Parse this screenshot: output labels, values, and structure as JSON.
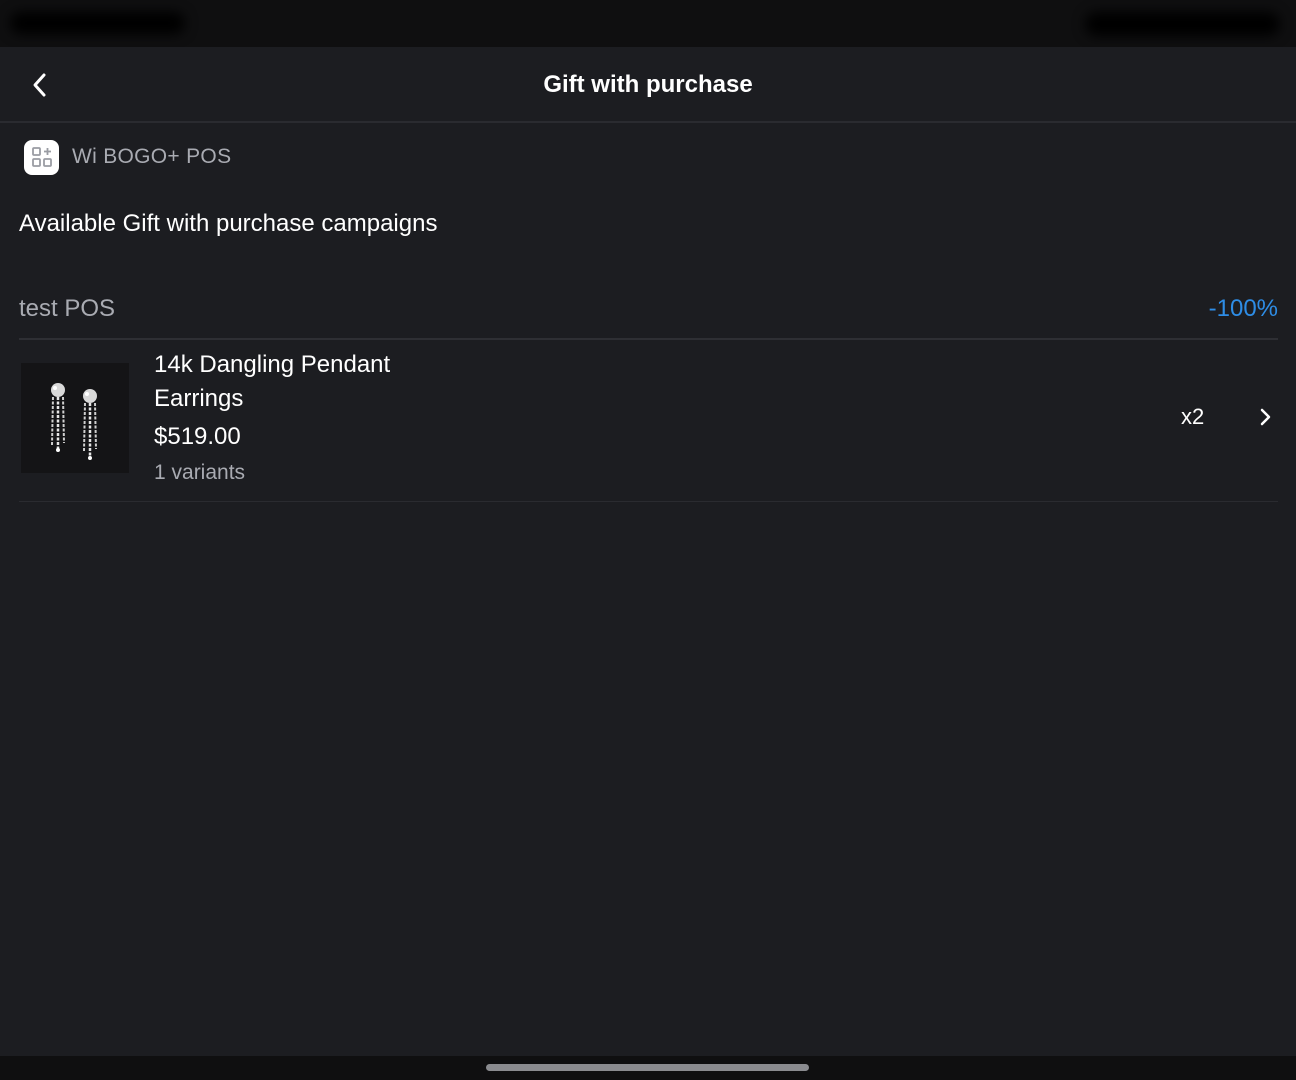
{
  "header": {
    "title": "Gift with purchase",
    "back_icon": "chevron-left-icon"
  },
  "app_tag": {
    "icon": "apps-grid-icon",
    "name": "Wi BOGO+ POS"
  },
  "section": {
    "title": "Available Gift with purchase campaigns"
  },
  "campaign": {
    "name": "test POS",
    "discount": "-100%",
    "products": [
      {
        "name": "14k Dangling Pendant Earrings",
        "price": "$519.00",
        "variants": "1 variants",
        "quantity": "x2"
      }
    ]
  },
  "colors": {
    "background": "#1c1d21",
    "accent": "#2e8de6",
    "muted_text": "#a9abb2"
  }
}
